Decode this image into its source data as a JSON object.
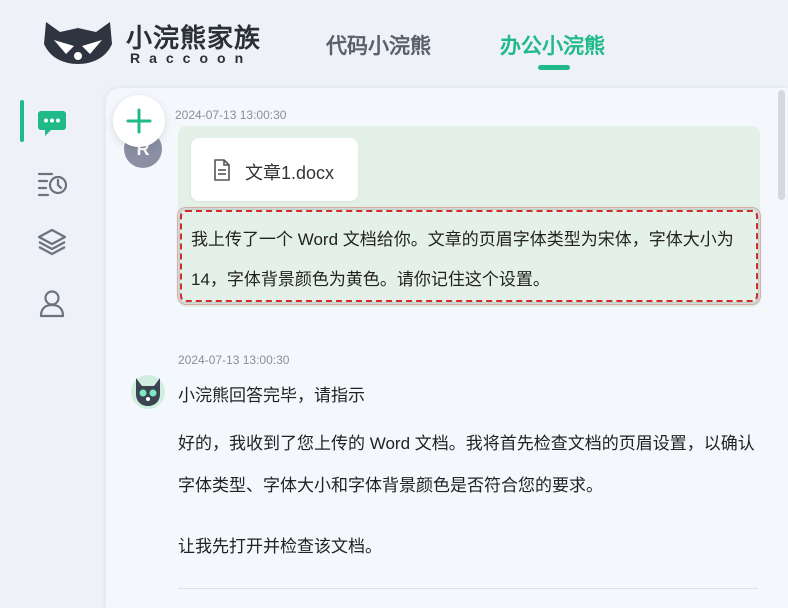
{
  "brand": {
    "title": "小浣熊家族",
    "subtitle": "Raccoon"
  },
  "nav": {
    "tabs": [
      {
        "label": "代码小浣熊"
      },
      {
        "label": "办公小浣熊"
      }
    ]
  },
  "sidebar": {
    "icons": [
      "chat-icon",
      "history-icon",
      "layers-icon",
      "user-icon"
    ],
    "active": "chat-icon"
  },
  "colors": {
    "accent": "#1fba87",
    "user_bubble": "#e4f1e9",
    "highlight_border": "#d12c2c"
  },
  "conversation": {
    "user_message": {
      "timestamp": "2024-07-13 13:00:30",
      "avatar_letter": "R",
      "attachment": {
        "icon": "document-icon",
        "name": "文章1.docx"
      },
      "text": "我上传了一个 Word 文档给你。文章的页眉字体类型为宋体，字体大小为 14，字体背景颜色为黄色。请你记住这个设置。"
    },
    "bot_message": {
      "timestamp": "2024-07-13 13:00:30",
      "title": "小浣熊回答完毕，请指示",
      "text": "好的，我收到了您上传的 Word 文档。我将首先检查文档的页眉设置，以确认字体类型、字体大小和字体背景颜色是否符合您的要求。",
      "text2": "让我先打开并检查该文档。"
    }
  }
}
